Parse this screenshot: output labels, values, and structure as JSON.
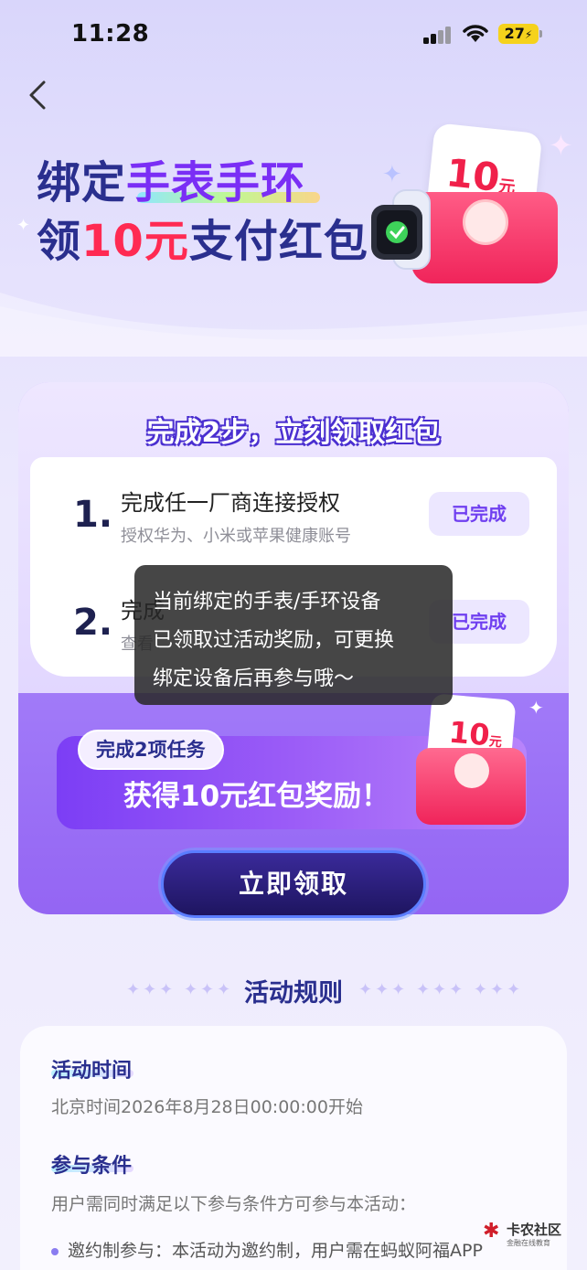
{
  "status_bar": {
    "time": "11:28",
    "battery": "27"
  },
  "hero": {
    "line1_prefix": "绑定",
    "line1_highlight": "手表手环",
    "line2_prefix": "领",
    "line2_highlight": "10元",
    "line2_suffix": "支付红包",
    "envelope_amount": "10",
    "envelope_unit": "元"
  },
  "task_card": {
    "title": "完成2步，立刻领取红包",
    "steps": [
      {
        "number": "1.",
        "title": "完成任一厂商连接授权",
        "desc": "授权华为、小米或苹果健康账号",
        "status": "已完成"
      },
      {
        "number": "2.",
        "title": "完成",
        "desc": "查看",
        "status": "已完成"
      }
    ]
  },
  "reward": {
    "tag": "完成2项任务",
    "text": "获得10元红包奖励！",
    "envelope_amount": "10",
    "envelope_unit": "元"
  },
  "claim_button": "立即领取",
  "toast": {
    "line1": "当前绑定的手表/手环设备",
    "line2": "已领取过活动奖励，可更换",
    "line3": "绑定设备后再参与哦～"
  },
  "rules": {
    "title": "活动规则",
    "time_heading": "活动时间",
    "time_text": "北京时间2026年8月28日00:00:00开始",
    "cond_heading": "参与条件",
    "cond_text": "用户需同时满足以下参与条件方可参与本活动：",
    "bullet_label": "邀约制参与：",
    "bullet_text": "本活动为邀约制，用户需在蚂蚁阿福APP"
  },
  "watermark": {
    "main": "卡农社区",
    "sub": "金融在线教育"
  }
}
